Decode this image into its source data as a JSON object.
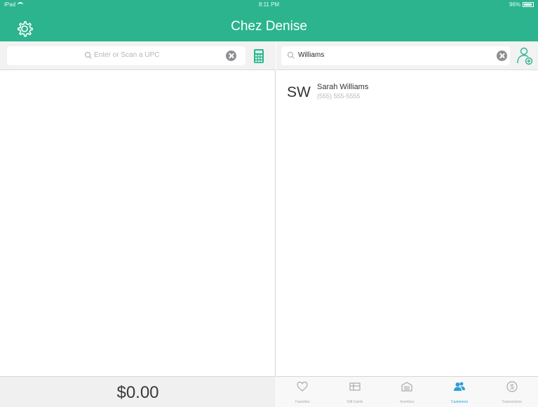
{
  "status_bar": {
    "carrier": "iPad",
    "time": "8:11 PM",
    "battery": "96%"
  },
  "header": {
    "title": "Chez Denise"
  },
  "left": {
    "upc_placeholder": "Enter or Scan a UPC",
    "total": "$0.00"
  },
  "right": {
    "search_value": "Williams",
    "customers": [
      {
        "initials": "SW",
        "name": "Sarah Williams",
        "phone": "(555) 555-5555"
      }
    ],
    "tabs": [
      {
        "label": "Favorites",
        "icon": "heart-icon",
        "active": false
      },
      {
        "label": "Gift Cards",
        "icon": "gift-card-icon",
        "active": false
      },
      {
        "label": "Inventory",
        "icon": "inventory-icon",
        "active": false
      },
      {
        "label": "Customers",
        "icon": "customers-icon",
        "active": true
      },
      {
        "label": "Transactions",
        "icon": "dollar-icon",
        "active": false
      }
    ]
  },
  "colors": {
    "brand": "#2bb48e",
    "active_tab": "#2f9fd6"
  }
}
